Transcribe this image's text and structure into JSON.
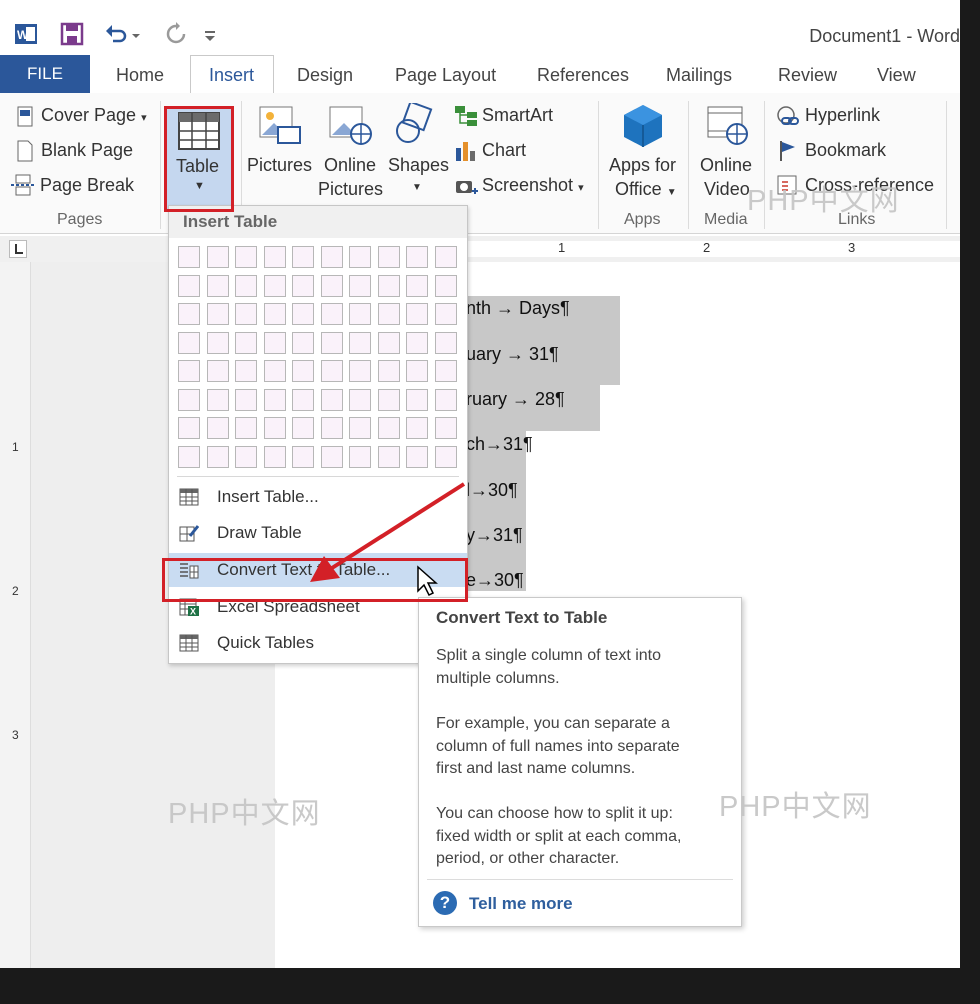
{
  "window": {
    "title": "Document1 - Word"
  },
  "tabs": [
    {
      "label": "FILE"
    },
    {
      "label": "Home"
    },
    {
      "label": "Insert"
    },
    {
      "label": "Design"
    },
    {
      "label": "Page Layout"
    },
    {
      "label": "References"
    },
    {
      "label": "Mailings"
    },
    {
      "label": "Review"
    },
    {
      "label": "View"
    }
  ],
  "ribbon": {
    "pages": {
      "cover_page": "Cover Page",
      "blank_page": "Blank Page",
      "page_break": "Page Break",
      "group": "Pages"
    },
    "tables": {
      "table_line1": "Table"
    },
    "illustrations": {
      "pictures": "Pictures",
      "online_line1": "Online",
      "online_line2": "Pictures",
      "shapes": "Shapes",
      "smartart": "SmartArt",
      "chart": "Chart",
      "screenshot": "Screenshot"
    },
    "apps": {
      "line1": "Apps for",
      "line2": "Office",
      "group": "Apps"
    },
    "media": {
      "line1": "Online",
      "line2": "Video",
      "group": "Media"
    },
    "links": {
      "hyperlink": "Hyperlink",
      "bookmark": "Bookmark",
      "cross_reference": "Cross-reference",
      "group": "Links"
    }
  },
  "ruler": {
    "marks": [
      "1",
      "2",
      "3"
    ]
  },
  "document": {
    "lines": [
      {
        "text": "nth   →    Days¶"
      },
      {
        "text": "uary  →   31¶"
      },
      {
        "text": "ruary  →   28¶"
      },
      {
        "text": "ch→31¶"
      },
      {
        "text": "l→30¶"
      },
      {
        "text": "y→31¶"
      },
      {
        "text": "e→30¶"
      }
    ]
  },
  "dropdown": {
    "header": "Insert Table",
    "items": [
      {
        "label": "Insert Table..."
      },
      {
        "label": "Draw Table"
      },
      {
        "label": "Convert Text to Table..."
      },
      {
        "label": "Excel Spreadsheet"
      },
      {
        "label": "Quick Tables"
      }
    ]
  },
  "tooltip": {
    "title": "Convert Text to Table",
    "p1_line1": "Split a single column of text into",
    "p1_line2": "multiple columns.",
    "p2_line1": "For example, you can separate a",
    "p2_line2": "column of full names into separate",
    "p2_line3": "first and last name columns.",
    "p3_line1": "You can choose how to split it up:",
    "p3_line2": "fixed width or split at each comma,",
    "p3_line3": "period, or other character.",
    "link": "Tell me more"
  },
  "watermarks": [
    "PHP中文网",
    "PHP中文网",
    "PHP中文网"
  ],
  "colors": {
    "accent": "#2b579a",
    "highlight": "#d32027"
  }
}
